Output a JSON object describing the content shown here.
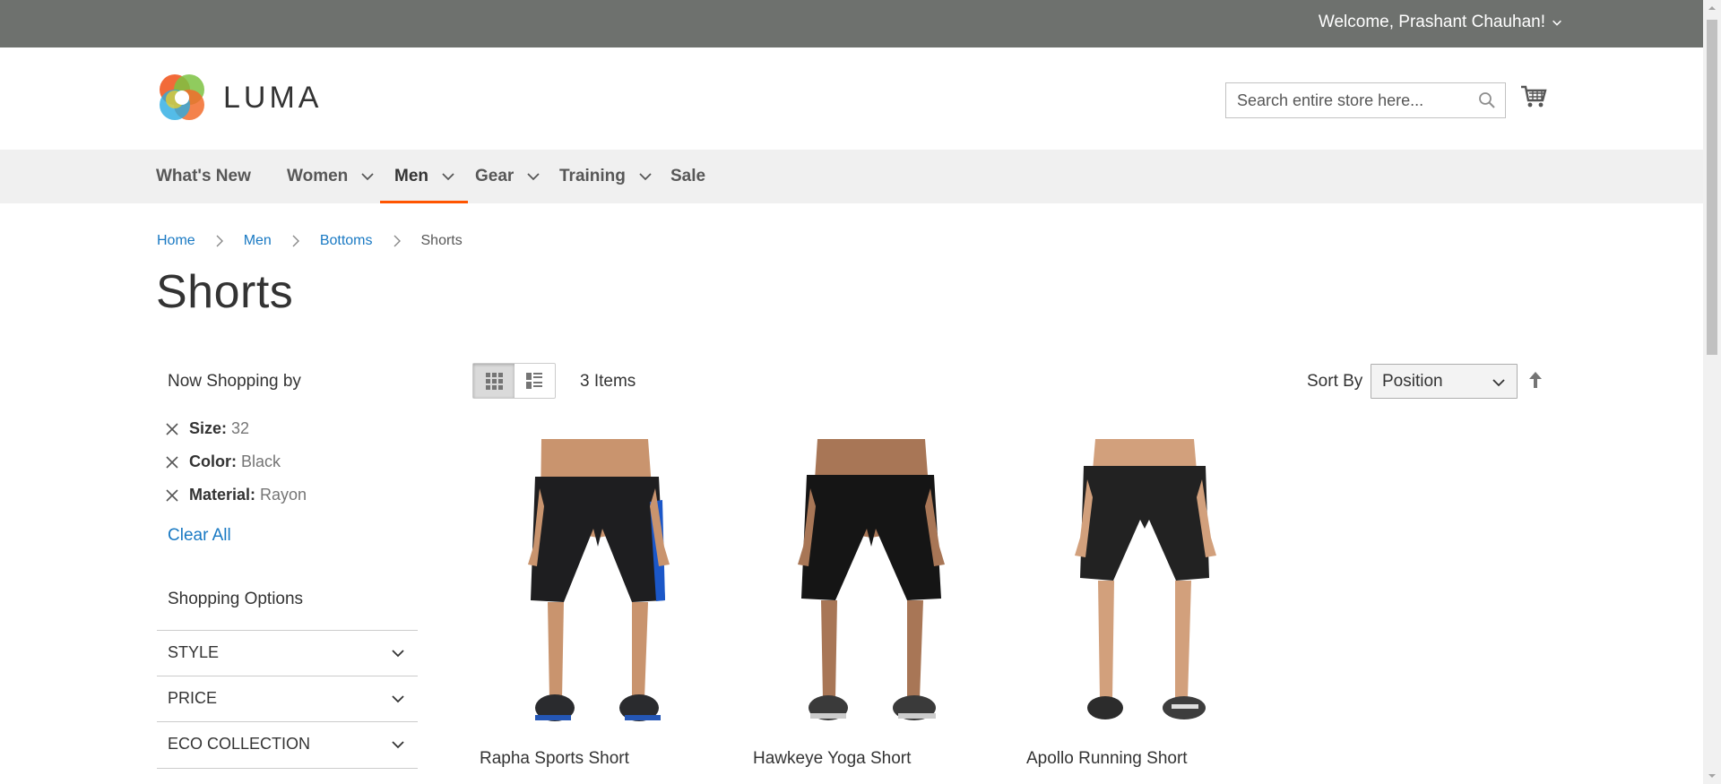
{
  "header": {
    "welcome": "Welcome, Prashant Chauhan!",
    "logo_text": "LUMA",
    "search_placeholder": "Search entire store here..."
  },
  "nav": {
    "items": [
      {
        "label": "What's New"
      },
      {
        "label": "Women"
      },
      {
        "label": "Men"
      },
      {
        "label": "Gear"
      },
      {
        "label": "Training"
      },
      {
        "label": "Sale"
      }
    ],
    "active": "Men"
  },
  "breadcrumbs": [
    "Home",
    "Men",
    "Bottoms",
    "Shorts"
  ],
  "page_title": "Shorts",
  "sidebar": {
    "now_shopping_title": "Now Shopping by",
    "filters": [
      {
        "label": "Size:",
        "value": "32"
      },
      {
        "label": "Color:",
        "value": "Black"
      },
      {
        "label": "Material:",
        "value": "Rayon"
      }
    ],
    "clear_all": "Clear All",
    "shopping_options_title": "Shopping Options",
    "options": [
      "STYLE",
      "PRICE",
      "ECO COLLECTION"
    ]
  },
  "toolbar": {
    "amount": "3 Items",
    "sort_by_label": "Sort By",
    "sort_value": "Position",
    "view_mode": "grid"
  },
  "products": [
    {
      "name": "Rapha Sports Short"
    },
    {
      "name": "Hawkeye Yoga Short"
    },
    {
      "name": "Apollo Running Short"
    }
  ],
  "colors": {
    "topbar": "#6e716e",
    "nav_bg": "#f0f0f0",
    "accent": "#ff5501",
    "link": "#1979c3"
  }
}
